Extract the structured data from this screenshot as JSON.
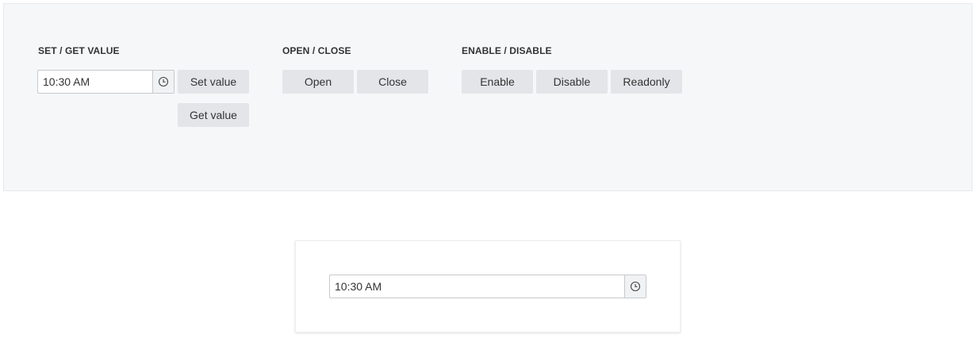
{
  "config": {
    "set_get": {
      "title": "SET / GET VALUE",
      "picker_value": "10:30 AM",
      "clock_icon": "clock-icon",
      "set_label": "Set value",
      "get_label": "Get value"
    },
    "open_close": {
      "title": "OPEN / CLOSE",
      "open_label": "Open",
      "close_label": "Close"
    },
    "enable_disable": {
      "title": "ENABLE / DISABLE",
      "enable_label": "Enable",
      "disable_label": "Disable",
      "readonly_label": "Readonly"
    }
  },
  "demo": {
    "picker_value": "10:30 AM",
    "clock_icon": "clock-icon"
  },
  "colors": {
    "config_bg": "#f6f7f9",
    "button_bg": "#e4e5e8",
    "border": "#c7c9cc",
    "text": "#333333"
  }
}
